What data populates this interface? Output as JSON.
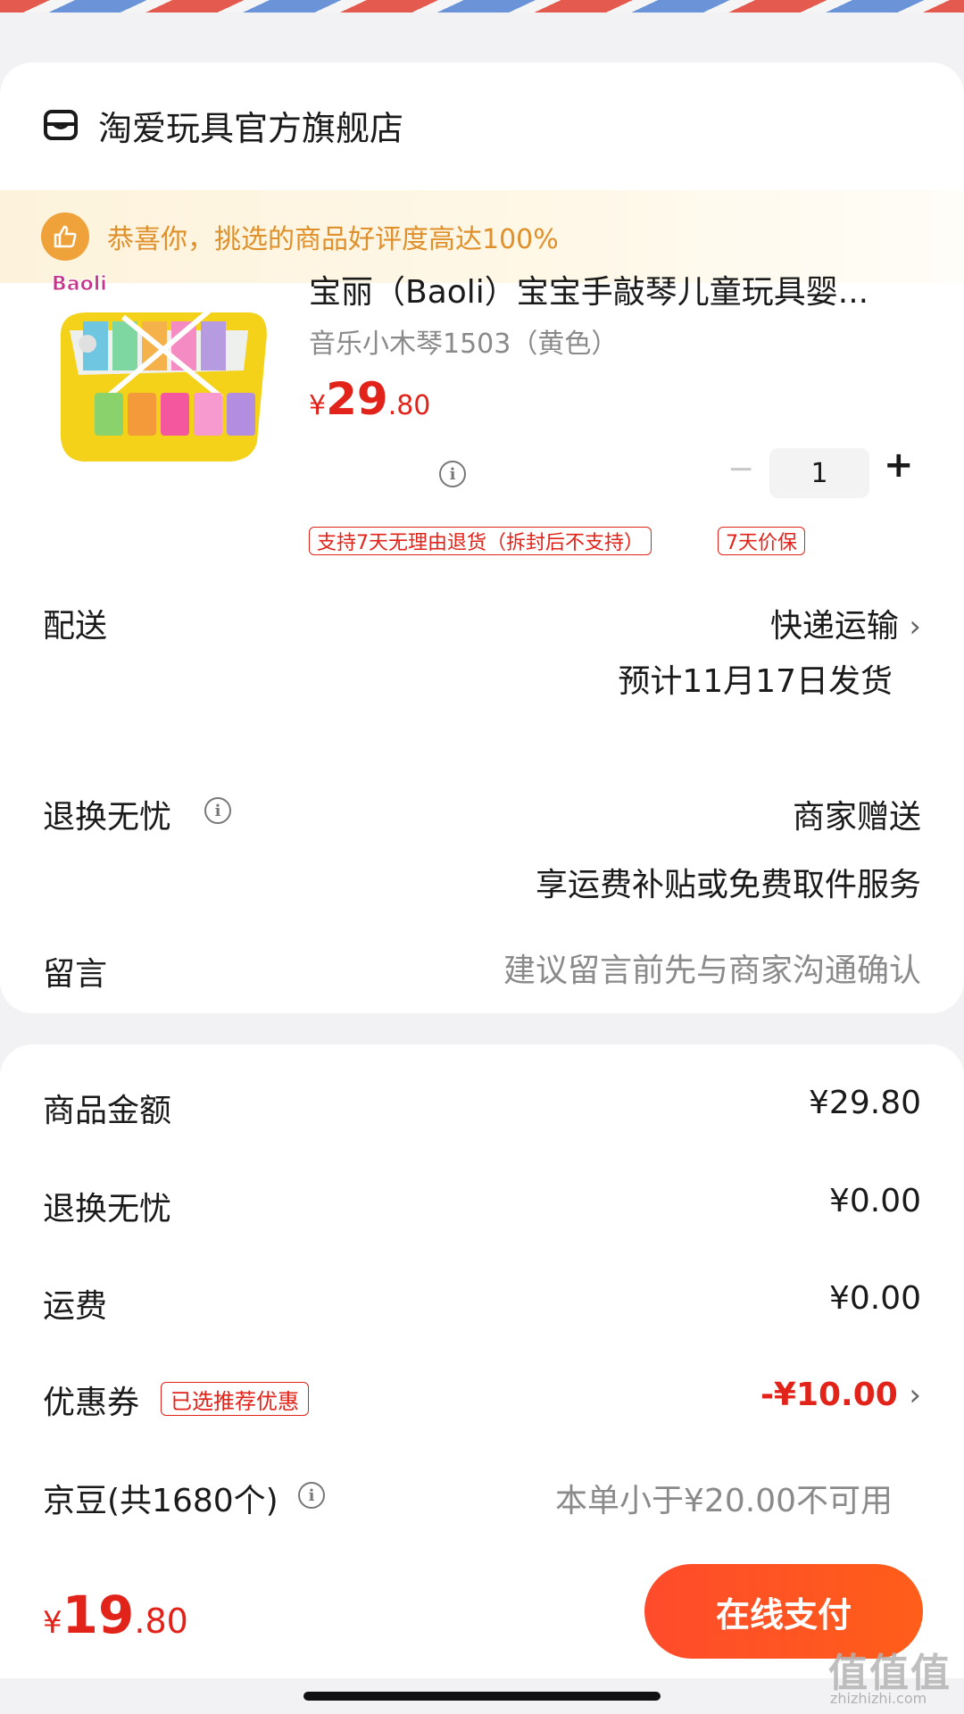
{
  "store": {
    "name": "淘爱玩具官方旗舰店",
    "icon": "store-icon"
  },
  "banner": {
    "text": "恭喜你，挑选的商品好评度高达100%",
    "icon": "thumbs-up-icon"
  },
  "product": {
    "title": "宝丽（Baoli）宝宝手敲琴儿童玩具婴...",
    "spec": "音乐小木琴1503（黄色）",
    "price_currency": "¥",
    "price_int": "29",
    "price_dec": ".80",
    "quantity": "1",
    "minus": "−",
    "plus": "+",
    "tags": [
      "支持7天无理由退货（拆封后不支持）",
      "7天价保"
    ],
    "image_brand": "Baoli"
  },
  "delivery": {
    "label": "配送",
    "method": "快递运输",
    "eta": "预计11月17日发货"
  },
  "returns": {
    "label": "退换无忧",
    "value": "商家赠送",
    "desc": "享运费补贴或免费取件服务"
  },
  "message": {
    "label": "留言",
    "placeholder": "建议留言前先与商家沟通确认"
  },
  "summary": {
    "goods_label": "商品金额",
    "goods_value": "¥29.80",
    "returns_label": "退换无忧",
    "returns_value": "¥0.00",
    "shipping_label": "运费",
    "shipping_value": "¥0.00",
    "coupon_label": "优惠券",
    "coupon_tag": "已选推荐优惠",
    "coupon_value": "-¥10.00",
    "jingdou_label": "京豆(共1680个)",
    "jingdou_value": "本单小于¥20.00不可用"
  },
  "footer": {
    "total_currency": "¥",
    "total_int": "19",
    "total_dec": ".80",
    "pay_label": "在线支付"
  },
  "watermark": {
    "text": "值值值",
    "sub": "zhizhizhi.com"
  },
  "colors": {
    "accent_red": "#e2231a",
    "banner_orange": "#e0902a",
    "pay_gradient_start": "#ff4b2b"
  }
}
